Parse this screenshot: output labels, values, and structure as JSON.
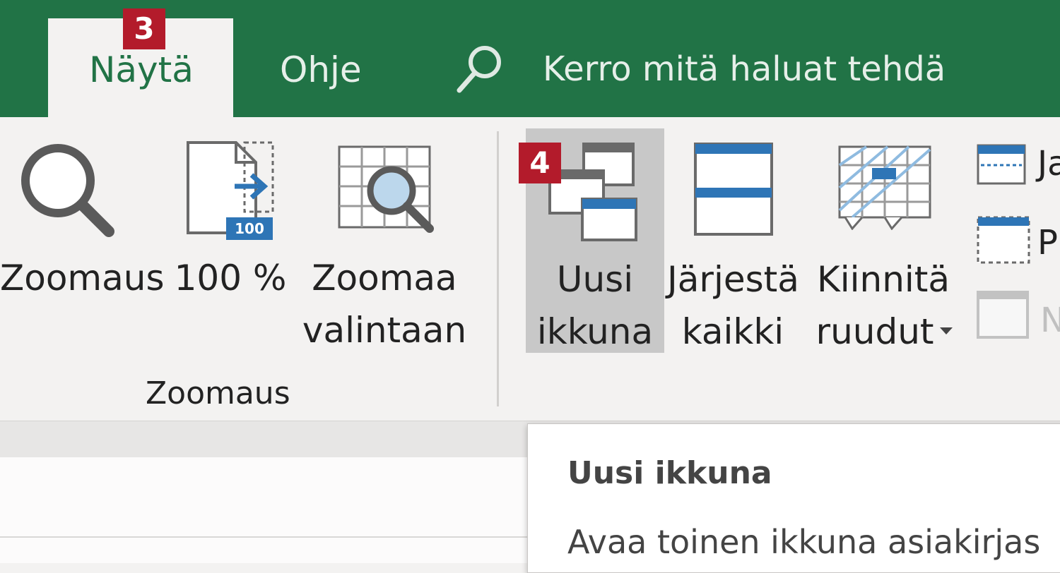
{
  "tabs": {
    "active_label": "Näytä",
    "active_badge": "3",
    "help_label": "Ohje",
    "search_placeholder": "Kerro mitä haluat tehdä"
  },
  "zoom_group": {
    "label": "Zoomaus",
    "zoom_button": "Zoomaus",
    "hundred_button": "100 %",
    "hundred_icon_text": "100",
    "zoom_selection_line1": "Zoomaa",
    "zoom_selection_line2": "valintaan"
  },
  "window_group": {
    "new_window_badge": "4",
    "new_window_line1": "Uusi",
    "new_window_line2": "ikkuna",
    "arrange_line1": "Järjestä",
    "arrange_line2": "kaikki",
    "freeze_line1": "Kiinnitä",
    "freeze_line2": "ruudut",
    "split_label": "Ja",
    "hide_label": "P",
    "unhide_label": "N"
  },
  "tooltip": {
    "title": "Uusi ikkuna",
    "description": "Avaa toinen ikkuna asiakirjas"
  },
  "colors": {
    "header_green": "#217346",
    "accent_blue": "#2e75b6",
    "badge_red": "#b31b2b",
    "ribbon_bg": "#f3f2f1"
  }
}
